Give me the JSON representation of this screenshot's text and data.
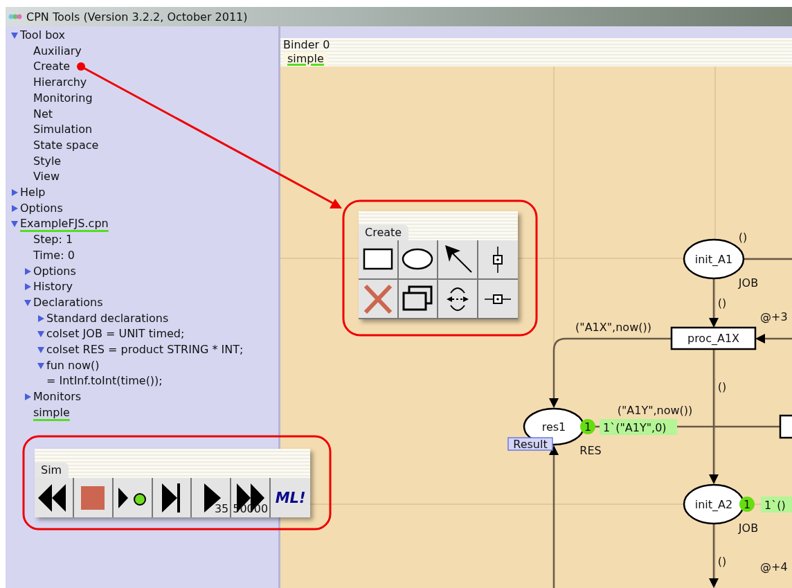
{
  "window": {
    "title": "CPN Tools (Version 3.2.2, October 2011)"
  },
  "index": [
    {
      "label": "Tool box",
      "kind": "folder",
      "expanded": true,
      "open": false,
      "children": [
        {
          "label": "Auxiliary",
          "kind": "leaf",
          "open": false
        },
        {
          "label": "Create",
          "kind": "leaf",
          "open": false
        },
        {
          "label": "Hierarchy",
          "kind": "leaf",
          "open": false
        },
        {
          "label": "Monitoring",
          "kind": "leaf",
          "open": false
        },
        {
          "label": "Net",
          "kind": "leaf",
          "open": false
        },
        {
          "label": "Simulation",
          "kind": "leaf",
          "open": false
        },
        {
          "label": "State space",
          "kind": "leaf",
          "open": false
        },
        {
          "label": "Style",
          "kind": "leaf",
          "open": false
        },
        {
          "label": "View",
          "kind": "leaf",
          "open": false
        }
      ]
    },
    {
      "label": "Help",
      "kind": "folder",
      "expanded": false,
      "open": false
    },
    {
      "label": "Options",
      "kind": "folder",
      "expanded": false,
      "open": false
    },
    {
      "label": "ExampleFJS.cpn",
      "kind": "folder",
      "expanded": true,
      "open": true,
      "children": [
        {
          "label": "Step: 1",
          "kind": "leaf",
          "open": false
        },
        {
          "label": "Time: 0",
          "kind": "leaf",
          "open": false
        },
        {
          "label": "Options",
          "kind": "folder",
          "expanded": false,
          "open": false
        },
        {
          "label": "History",
          "kind": "folder",
          "expanded": false,
          "open": false
        },
        {
          "label": "Declarations",
          "kind": "folder",
          "expanded": true,
          "open": false,
          "children": [
            {
              "label": "Standard declarations",
              "kind": "folder",
              "expanded": false,
              "open": false
            },
            {
              "label": "colset JOB = UNIT timed;",
              "kind": "folder",
              "expanded": true,
              "open": false
            },
            {
              "label": "colset RES = product STRING * INT;",
              "kind": "folder",
              "expanded": true,
              "open": false
            },
            {
              "label": "fun now()\n= IntInf.toInt(time());",
              "kind": "folder",
              "expanded": true,
              "open": false
            }
          ]
        },
        {
          "label": "Monitors",
          "kind": "folder",
          "expanded": false,
          "open": false
        },
        {
          "label": "simple",
          "kind": "leaf",
          "open": true
        }
      ]
    }
  ],
  "binder": {
    "title": "Binder 0",
    "tabs": [
      {
        "label": "simple",
        "selected": true
      }
    ]
  },
  "palettes": [
    {
      "title": "Create",
      "tools": [
        {
          "kind": "rectangle"
        },
        {
          "kind": "ellipse"
        },
        {
          "kind": "arrow"
        },
        {
          "kind": "port-vertical"
        },
        {
          "kind": "delete"
        },
        {
          "kind": "clone"
        },
        {
          "kind": "flip"
        },
        {
          "kind": "port-horizontal"
        }
      ]
    },
    {
      "title": "Sim",
      "tools": [
        {
          "kind": "rewind"
        },
        {
          "kind": "stop"
        },
        {
          "kind": "play-dot"
        },
        {
          "kind": "step-end"
        },
        {
          "kind": "play",
          "count": "35"
        },
        {
          "kind": "fast-forward",
          "count": "50000"
        },
        {
          "kind": "ml",
          "label": "ML!"
        }
      ]
    }
  ],
  "net": {
    "places": [
      {
        "name": "init_A1",
        "type": "JOB",
        "initial": "()"
      },
      {
        "name": "res1",
        "type": "RES",
        "tokens": "1",
        "marking": "1`(\"A1Y\",0)",
        "monitor": "Result"
      },
      {
        "name": "init_A2",
        "type": "JOB",
        "tokens": "1",
        "marking": "1`()"
      }
    ],
    "transitions": [
      {
        "name": "proc_A1X"
      }
    ],
    "inscriptions": [
      "()",
      "(\"A1X\",now())",
      "@+3",
      "()",
      "(\"A1Y\",now())",
      "()",
      "@+4"
    ]
  }
}
